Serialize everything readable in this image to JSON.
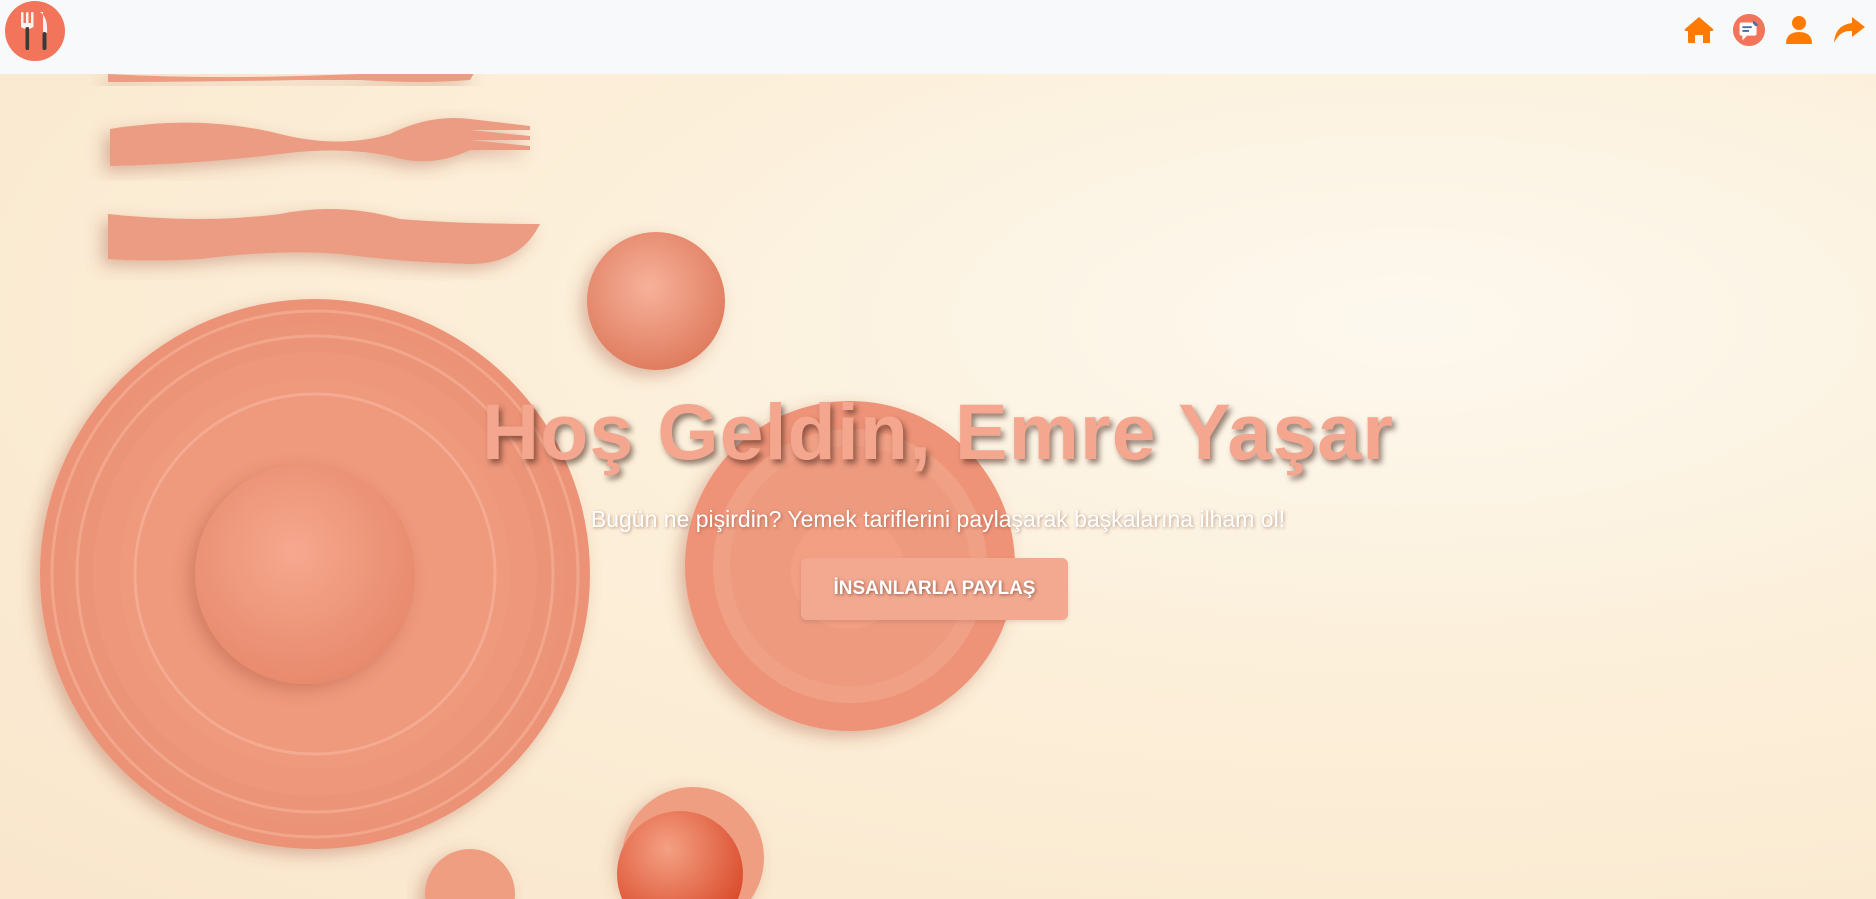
{
  "navbar": {
    "logo_icon": "fork-knife-icon",
    "icons": [
      "home-icon",
      "chat-icon",
      "user-icon",
      "share-arrow-icon"
    ],
    "accent_color": "#ff7a00",
    "logo_color": "#f2745a"
  },
  "hero": {
    "title": "Hoş Geldin, Emre Yaşar",
    "subtitle": "Bugün ne pişirdin? Yemek tariflerini paylaşarak başkalarına ilham ol!",
    "button_label": "İNSANLARLA PAYLAŞ",
    "title_color": "#f4a68e",
    "button_color": "#f3a890"
  }
}
